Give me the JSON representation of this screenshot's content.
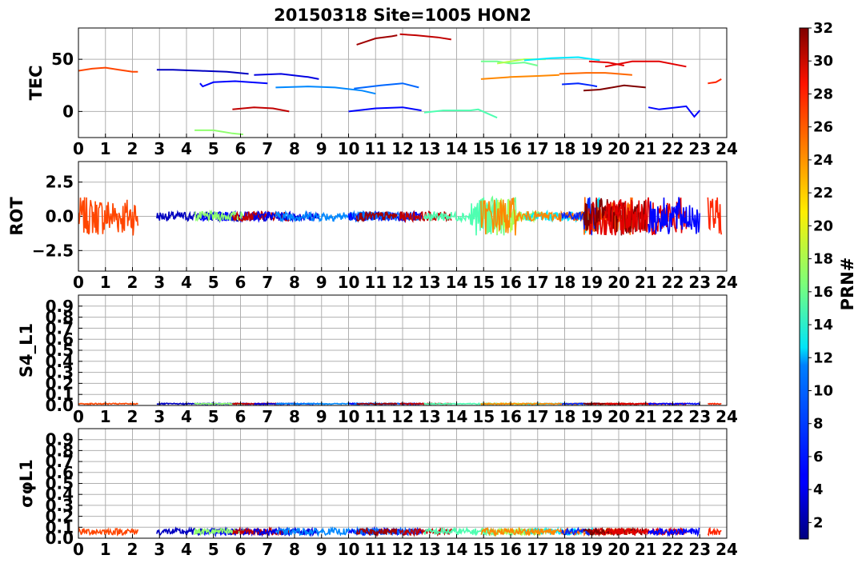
{
  "chart_data": {
    "type": "line",
    "title": "20150318 Site=1005 HON2",
    "x_ticks": [
      "0",
      "1",
      "2",
      "3",
      "4",
      "5",
      "6",
      "7",
      "8",
      "9",
      "10",
      "11",
      "12",
      "13",
      "14",
      "15",
      "16",
      "17",
      "18",
      "19",
      "20",
      "21",
      "22",
      "23",
      "24"
    ],
    "xlim": [
      0,
      24
    ],
    "grid": true,
    "colorbar": {
      "label": "PRN#",
      "range": [
        1,
        32
      ],
      "ticks": [
        "2",
        "4",
        "6",
        "8",
        "10",
        "12",
        "14",
        "16",
        "18",
        "20",
        "22",
        "24",
        "26",
        "28",
        "30",
        "32"
      ],
      "colormap": "jet"
    },
    "panels": [
      {
        "ylabel": "TEC",
        "ylim": [
          -25,
          80
        ],
        "y_ticks": [
          "0",
          "50"
        ],
        "series": [
          {
            "prn": 26,
            "points": [
              [
                0,
                39
              ],
              [
                0.5,
                41
              ],
              [
                1,
                42
              ],
              [
                1.5,
                40
              ],
              [
                2,
                38
              ],
              [
                2.2,
                38
              ]
            ]
          },
          {
            "prn": 3,
            "points": [
              [
                2.9,
                40
              ],
              [
                3.5,
                40
              ],
              [
                4.5,
                39
              ],
              [
                5.5,
                38
              ],
              [
                6.3,
                36
              ]
            ]
          },
          {
            "prn": 5,
            "points": [
              [
                4.5,
                27
              ],
              [
                4.6,
                24
              ],
              [
                5,
                28
              ],
              [
                5.8,
                29
              ],
              [
                7,
                27
              ]
            ]
          },
          {
            "prn": 17,
            "points": [
              [
                4.3,
                -18
              ],
              [
                5,
                -18
              ],
              [
                5.7,
                -21
              ],
              [
                6.1,
                -22
              ]
            ]
          },
          {
            "prn": 30,
            "points": [
              [
                5.7,
                2
              ],
              [
                6.5,
                4
              ],
              [
                7.2,
                3
              ],
              [
                7.8,
                0
              ]
            ]
          },
          {
            "prn": 4,
            "points": [
              [
                6.5,
                35
              ],
              [
                7.5,
                36
              ],
              [
                8.5,
                33
              ],
              [
                8.9,
                31
              ]
            ]
          },
          {
            "prn": 9,
            "points": [
              [
                7.3,
                23
              ],
              [
                8.5,
                24
              ],
              [
                9.5,
                23
              ],
              [
                10.5,
                20
              ],
              [
                11,
                17
              ]
            ]
          },
          {
            "prn": 5,
            "points": [
              [
                10,
                0
              ],
              [
                11,
                3
              ],
              [
                12,
                4
              ],
              [
                12.7,
                1
              ]
            ]
          },
          {
            "prn": 8,
            "points": [
              [
                10.2,
                22
              ],
              [
                11.2,
                25
              ],
              [
                12,
                27
              ],
              [
                12.6,
                23
              ]
            ]
          },
          {
            "prn": 31,
            "points": [
              [
                10.3,
                64
              ],
              [
                11,
                70
              ],
              [
                11.6,
                72
              ],
              [
                11.8,
                73
              ]
            ]
          },
          {
            "prn": 30,
            "points": [
              [
                11.9,
                74
              ],
              [
                12.5,
                73
              ],
              [
                13.3,
                71
              ],
              [
                13.8,
                69
              ]
            ]
          },
          {
            "prn": 15,
            "points": [
              [
                12.8,
                -1
              ],
              [
                13.5,
                1
              ],
              [
                14.5,
                1
              ],
              [
                14.8,
                2
              ],
              [
                15.5,
                -6
              ]
            ]
          },
          {
            "prn": 16,
            "points": [
              [
                14.9,
                48
              ],
              [
                15.5,
                48
              ],
              [
                16,
                46
              ],
              [
                16.5,
                47
              ],
              [
                17,
                44
              ]
            ]
          },
          {
            "prn": 18,
            "points": [
              [
                15.5,
                46
              ],
              [
                16.5,
                50
              ],
              [
                17.3,
                50
              ]
            ]
          },
          {
            "prn": 12,
            "points": [
              [
                16.5,
                49
              ],
              [
                17.5,
                51
              ],
              [
                18.5,
                52
              ],
              [
                19.3,
                49
              ]
            ]
          },
          {
            "prn": 24,
            "points": [
              [
                14.9,
                31
              ],
              [
                16,
                33
              ],
              [
                17,
                34
              ],
              [
                17.8,
                35
              ]
            ]
          },
          {
            "prn": 25,
            "points": [
              [
                17.8,
                36
              ],
              [
                18.8,
                37
              ],
              [
                19.5,
                37
              ],
              [
                20.5,
                35
              ]
            ]
          },
          {
            "prn": 6,
            "points": [
              [
                17.9,
                26
              ],
              [
                18.5,
                27
              ],
              [
                19,
                25
              ],
              [
                19.2,
                24
              ]
            ]
          },
          {
            "prn": 29,
            "points": [
              [
                18.9,
                48
              ],
              [
                19.6,
                47
              ],
              [
                20.2,
                44
              ]
            ]
          },
          {
            "prn": 32,
            "points": [
              [
                18.7,
                20
              ],
              [
                19.3,
                21
              ],
              [
                20.2,
                25
              ],
              [
                21,
                23
              ]
            ]
          },
          {
            "prn": 29,
            "points": [
              [
                19.5,
                43
              ],
              [
                20.5,
                48
              ],
              [
                21.5,
                48
              ],
              [
                22.5,
                43
              ]
            ]
          },
          {
            "prn": 5,
            "points": [
              [
                21.1,
                4
              ],
              [
                21.5,
                2
              ],
              [
                22.5,
                5
              ],
              [
                22.8,
                -5
              ],
              [
                23,
                1
              ]
            ]
          },
          {
            "prn": 27,
            "points": [
              [
                23.3,
                27
              ],
              [
                23.6,
                28
              ],
              [
                23.8,
                31
              ]
            ]
          }
        ]
      },
      {
        "ylabel": "ROT",
        "ylim": [
          -4,
          4
        ],
        "y_ticks": [
          "−2.5",
          "0.0",
          "2.5"
        ]
      },
      {
        "ylabel": "S4_L1",
        "ylim": [
          0,
          1
        ],
        "y_ticks": [
          "0.0",
          "0.1",
          "0.2",
          "0.3",
          "0.4",
          "0.5",
          "0.6",
          "0.7",
          "0.8",
          "0.9"
        ]
      },
      {
        "ylabel": "σφL1",
        "ylim": [
          0,
          1
        ],
        "y_ticks": [
          "0.0",
          "0.1",
          "0.2",
          "0.3",
          "0.4",
          "0.5",
          "0.6",
          "0.7",
          "0.8",
          "0.9"
        ]
      }
    ]
  }
}
